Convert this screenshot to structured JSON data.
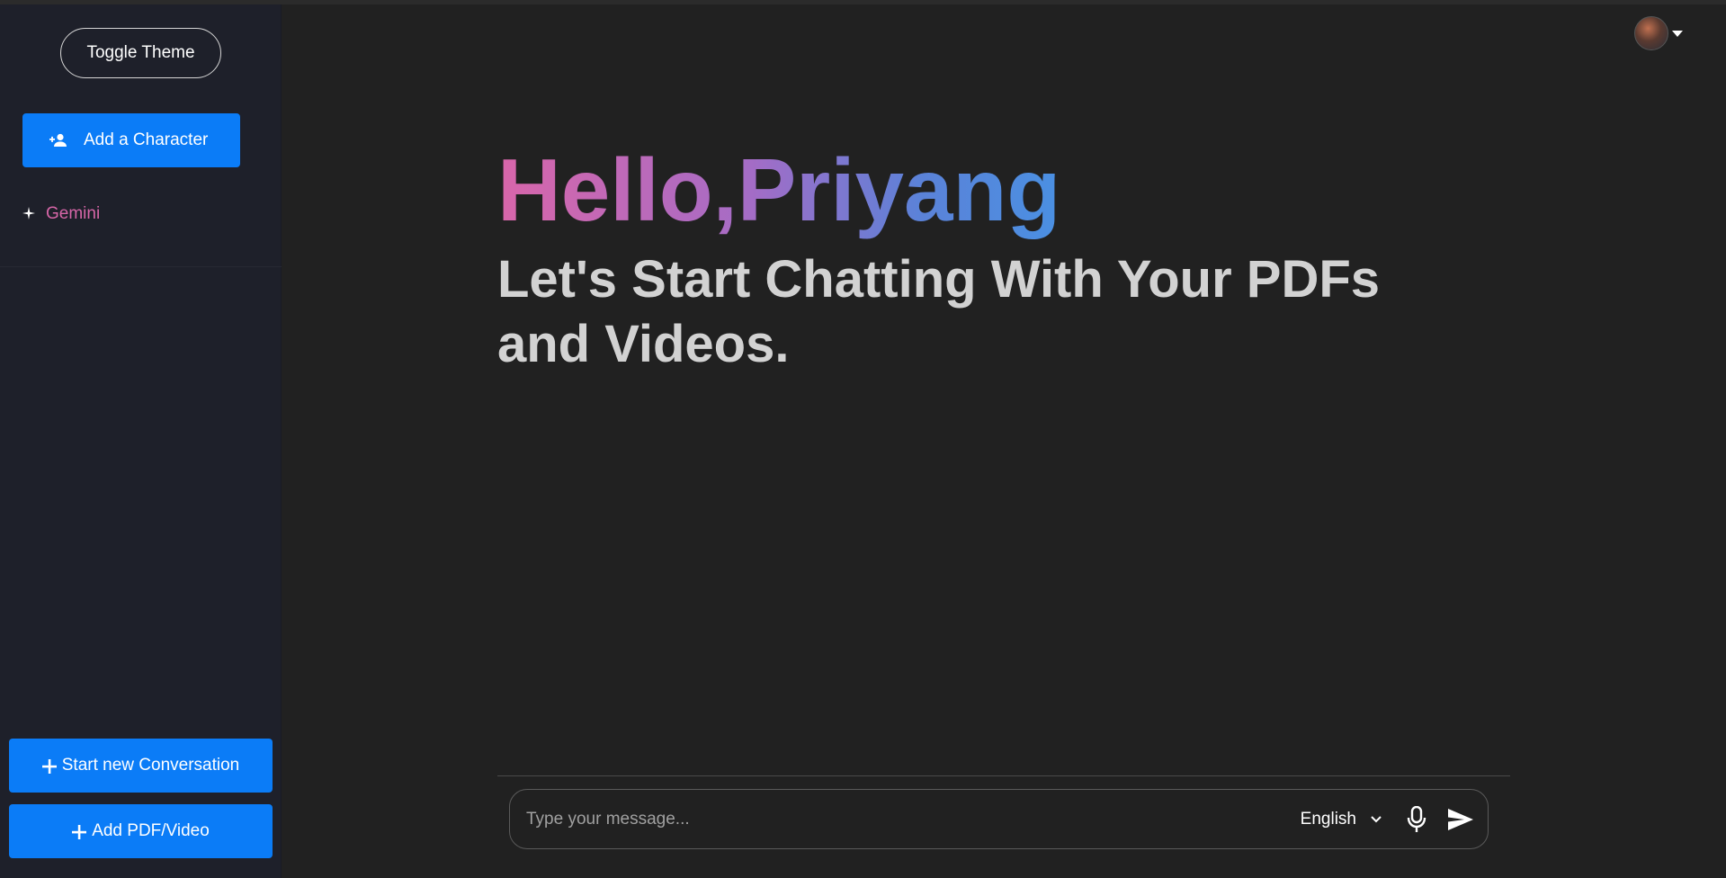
{
  "sidebar": {
    "toggle_theme_label": "Toggle Theme",
    "add_character_label": "Add a Character",
    "characters": [
      {
        "label": "Gemini",
        "icon": "sparkle-icon"
      }
    ],
    "start_new_label": "Start new Conversation",
    "add_pdf_label": "Add PDF/Video"
  },
  "header": {
    "avatar_icon": "user-avatar",
    "menu_icon": "caret-down-icon"
  },
  "main": {
    "greeting": "Hello,Priyang",
    "subtitle": "Let's Start Chatting With Your PDFs and Videos."
  },
  "chat_input": {
    "placeholder": "Type your message...",
    "value": "",
    "language": "English"
  },
  "colors": {
    "accent": "#0b7cf7",
    "sidebar_bg": "#1e202a",
    "main_bg": "#212121",
    "gradient_start": "#d966aa",
    "gradient_end": "#4a90e2",
    "character_name": "#d766a8"
  }
}
